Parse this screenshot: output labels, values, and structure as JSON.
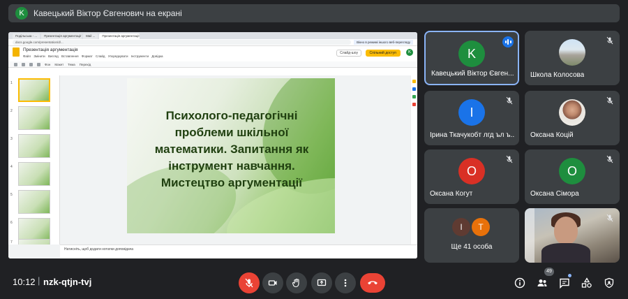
{
  "banner": {
    "avatar_letter": "K",
    "text": "Кавецький Віктор Євгенович на екрані"
  },
  "browser": {
    "tabs": [
      "Подільська - ...",
      "Презентація аргументації",
      "Mail ...",
      "Презентація аргументації"
    ],
    "address": "docs.google.com/presentation/d/...",
    "notice": "Вікно в режимі іншого веб-перегляду"
  },
  "doc": {
    "title": "Презентація аргументація",
    "menus": "Файл  Змінити  Вигляд  Вставлення  Формат  Слайд  Упорядкувати  Інструменти  Довідка",
    "present_label": "Слайд-шоу",
    "share_label": "Спільний доступ",
    "user_letter": "K",
    "toolbar": [
      "Фон",
      "Макет",
      "Тема",
      "Перехід"
    ],
    "thumb_numbers": [
      "1",
      "2",
      "3",
      "4",
      "5",
      "6",
      "7"
    ],
    "slide_title": "Психолого-педагогічні проблеми шкільної математики. Запитання як інструмент навчання. Мистецтво аргументації",
    "notes": "Натисніть, щоб додати нотатки доповідача"
  },
  "participants": [
    {
      "name": "Кавецький Віктор Євген...",
      "letter": "K",
      "color": "#1e8e3e",
      "speaking": true
    },
    {
      "name": "Школа Колосова",
      "letter": "",
      "color": "",
      "photo": "school"
    },
    {
      "name": "Ірина Ткачукобт лгд ъл ъ...",
      "letter": "І",
      "color": "#1a73e8"
    },
    {
      "name": "Оксана Коцій",
      "letter": "",
      "color": "",
      "photo": "oksana"
    },
    {
      "name": "Оксана Когут",
      "letter": "О",
      "color": "#d93025"
    },
    {
      "name": "Оксана Сімора",
      "letter": "О",
      "color": "#1e8e3e"
    }
  ],
  "more": {
    "letters": [
      "І",
      "Т"
    ],
    "colors": [
      "#5f3b32",
      "#e8710a"
    ],
    "label": "Ще 41 особа"
  },
  "video_tile": {
    "label": ""
  },
  "bottom": {
    "time": "10:12",
    "separator": "|",
    "meeting_code": "nzk-qtjn-tvj",
    "people_count": "49"
  },
  "icons": [
    "mic-off-icon",
    "camera-icon",
    "hand-icon",
    "present-icon",
    "more-icon",
    "end-call-icon",
    "info-icon",
    "people-icon",
    "chat-icon",
    "activities-icon",
    "host-controls-icon"
  ]
}
